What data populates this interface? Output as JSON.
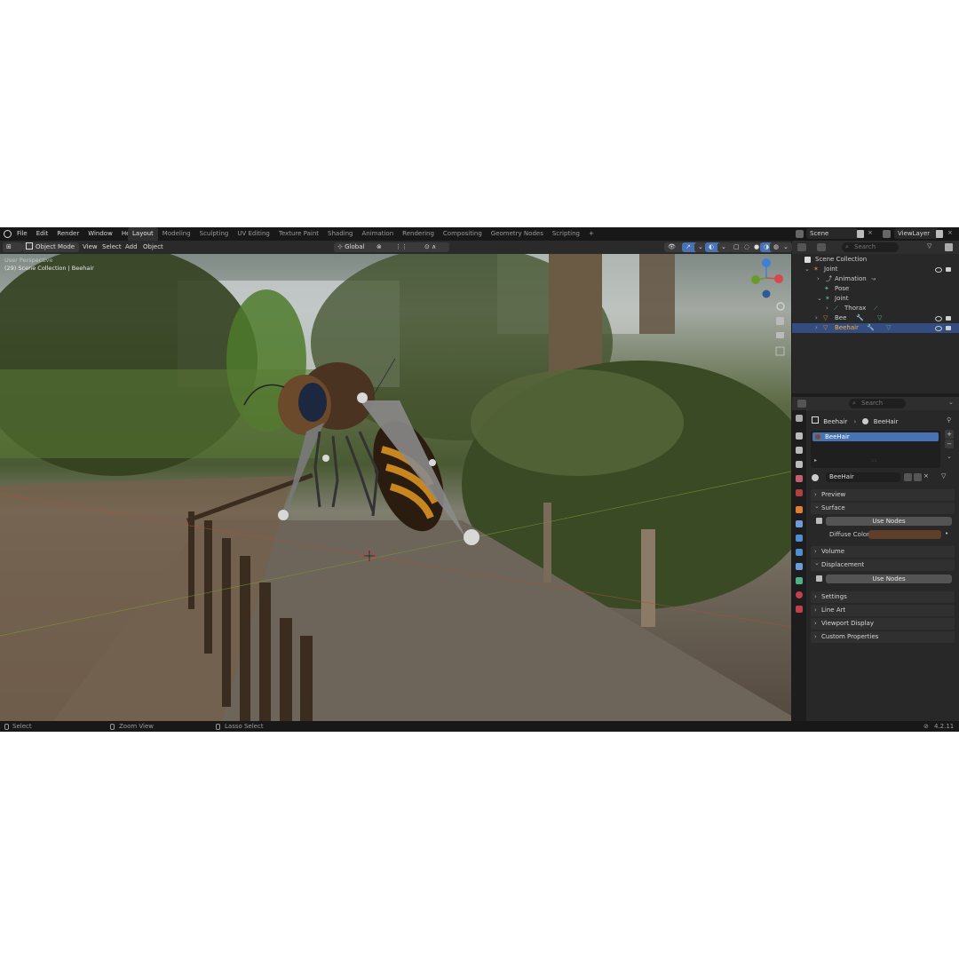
{
  "menu": [
    "File",
    "Edit",
    "Render",
    "Window",
    "Help"
  ],
  "workspaces": [
    "Layout",
    "Modeling",
    "Sculpting",
    "UV Editing",
    "Texture Paint",
    "Shading",
    "Animation",
    "Rendering",
    "Compositing",
    "Geometry Nodes",
    "Scripting"
  ],
  "active_workspace": "Layout",
  "scene_name": "Scene",
  "view_layer": "ViewLayer",
  "viewport_header": {
    "mode": "Object Mode",
    "menus": [
      "View",
      "Select",
      "Add",
      "Object"
    ],
    "orientation": "Global"
  },
  "viewport": {
    "overlay_line1": "User Perspective",
    "overlay_line2": "(29) Scene Collection | Beehair"
  },
  "outliner": {
    "search_placeholder": "Search",
    "rows": [
      {
        "label": "Scene Collection"
      },
      {
        "label": "Joint"
      },
      {
        "label": "Animation"
      },
      {
        "label": "Pose"
      },
      {
        "label": "Joint"
      },
      {
        "label": "Thorax"
      },
      {
        "label": "Bee"
      },
      {
        "label": "Beehair"
      }
    ]
  },
  "properties": {
    "search_placeholder": "Search",
    "breadcrumb_object": "Beehair",
    "breadcrumb_material": "BeeHair",
    "material_slot": "BeeHair",
    "material_name": "BeeHair",
    "panels": {
      "preview": "Preview",
      "surface": "Surface",
      "use_nodes": "Use Nodes",
      "diffuse_color_label": "Diffuse Color",
      "volume": "Volume",
      "displacement": "Displacement",
      "use_nodes_2": "Use Nodes",
      "settings": "Settings",
      "line_art": "Line Art",
      "viewport_display": "Viewport Display",
      "custom_properties": "Custom Properties"
    },
    "diffuse_color": "#5e3f27"
  },
  "statusbar": {
    "select": "Select",
    "zoom_view": "Zoom View",
    "lasso_select": "Lasso Select",
    "version": "4.2.11"
  },
  "colors": {
    "selection_blue": "#4772b3",
    "active_orange": "#ffaf29",
    "axis_x": "#d6484d",
    "axis_y": "#6a9b2a",
    "axis_z": "#3f7fd8"
  },
  "icons": [
    "blender-logo-icon",
    "editor-type-icon",
    "object-mode-icon",
    "global-orientation-icon",
    "snap-icon",
    "gizmo-icon",
    "overlay-icon",
    "shading-solid-icon",
    "shading-material-icon",
    "shading-rendered-icon",
    "zoom-icon",
    "hand-pan-icon",
    "camera-view-icon",
    "grid-icon",
    "filter-icon",
    "eye-icon",
    "camera-icon",
    "material-sphere-icon",
    "add-icon",
    "remove-icon",
    "pin-icon",
    "mouse-left-icon",
    "mouse-middle-icon",
    "mouse-right-icon"
  ]
}
